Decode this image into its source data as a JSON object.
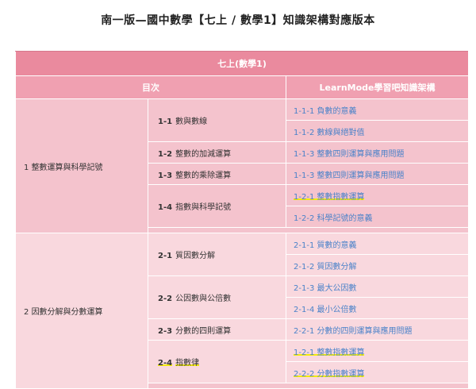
{
  "page_title": "南一版—國中數學【七上 / 數學1】知識架構對應版本",
  "table": {
    "title": "七上(數學1)",
    "header_left": "目次",
    "header_right": "LearnMode學習吧知識架構",
    "chapters": [
      {
        "num": "1",
        "name": "整數運算與科學記號",
        "sections": [
          {
            "num": "1-1",
            "name": "數與數線",
            "links": [
              "1-1-1 負數的意義",
              "1-1-2 數線與絕對值"
            ]
          },
          {
            "num": "1-2",
            "name": "整數的加減運算",
            "links": [
              "1-1-3 整數四則運算與應用問題"
            ]
          },
          {
            "num": "1-3",
            "name": "整數的乘除運算",
            "links": [
              "1-1-3 整數四則運算與應用問題"
            ]
          },
          {
            "num": "1-4",
            "name": "指數與科學記號",
            "links": [
              "1-2-1 整數指數運算",
              "1-2-2 科學記號的意義"
            ]
          }
        ]
      },
      {
        "num": "2",
        "name": "因數分解與分數運算",
        "sections": [
          {
            "num": "2-1",
            "name": "質因數分解",
            "links": [
              "2-1-1 質數的意義",
              "2-1-2 質因數分解"
            ]
          },
          {
            "num": "2-2",
            "name": "公因數與公倍數",
            "links": [
              "2-1-3 最大公因數",
              "2-1-4 最小公倍數"
            ]
          },
          {
            "num": "2-3",
            "name": "分數的四則運算",
            "links": [
              "2-2-1 分數的四則運算與應用問題"
            ]
          },
          {
            "num": "2-4",
            "name": "指數律",
            "links": [
              "1-2-1 整數指數運算",
              "2-2-2 分數指數運算"
            ]
          }
        ]
      }
    ]
  },
  "colors": {
    "title_bar": "#ea8a9e",
    "header_bar": "#f0a0b1",
    "chapter1_bg": "#f4c3cd",
    "chapter2_bg": "#f9d8de",
    "link": "#4a82c9",
    "highlight": "#f2ea0a"
  }
}
